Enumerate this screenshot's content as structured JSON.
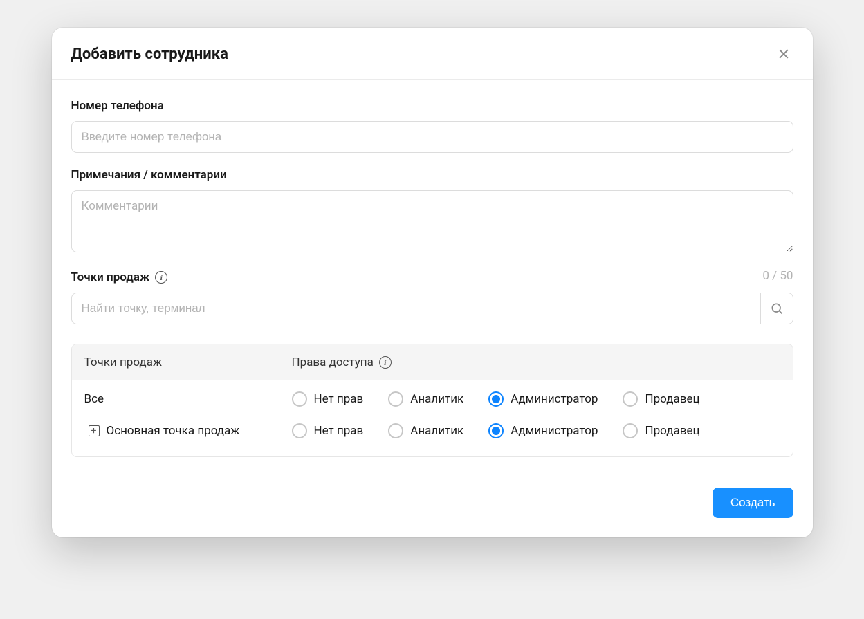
{
  "modal": {
    "title": "Добавить сотрудника"
  },
  "form": {
    "phone": {
      "label": "Номер телефона",
      "placeholder": "Введите номер телефона",
      "value": ""
    },
    "comments": {
      "label": "Примечания / комментарии",
      "placeholder": "Комментарии",
      "value": "",
      "counter": "0 / 50"
    },
    "points": {
      "label": "Точки продаж",
      "search_placeholder": "Найти точку, терминал",
      "search_value": ""
    }
  },
  "table": {
    "headers": {
      "points": "Точки продаж",
      "rights": "Права доступа"
    },
    "role_options": [
      "Нет прав",
      "Аналитик",
      "Администратор",
      "Продавец"
    ],
    "rows": [
      {
        "name": "Все",
        "expandable": false,
        "selected": "Администратор"
      },
      {
        "name": "Основная точка продаж",
        "expandable": true,
        "selected": "Администратор"
      }
    ]
  },
  "actions": {
    "create": "Создать"
  }
}
